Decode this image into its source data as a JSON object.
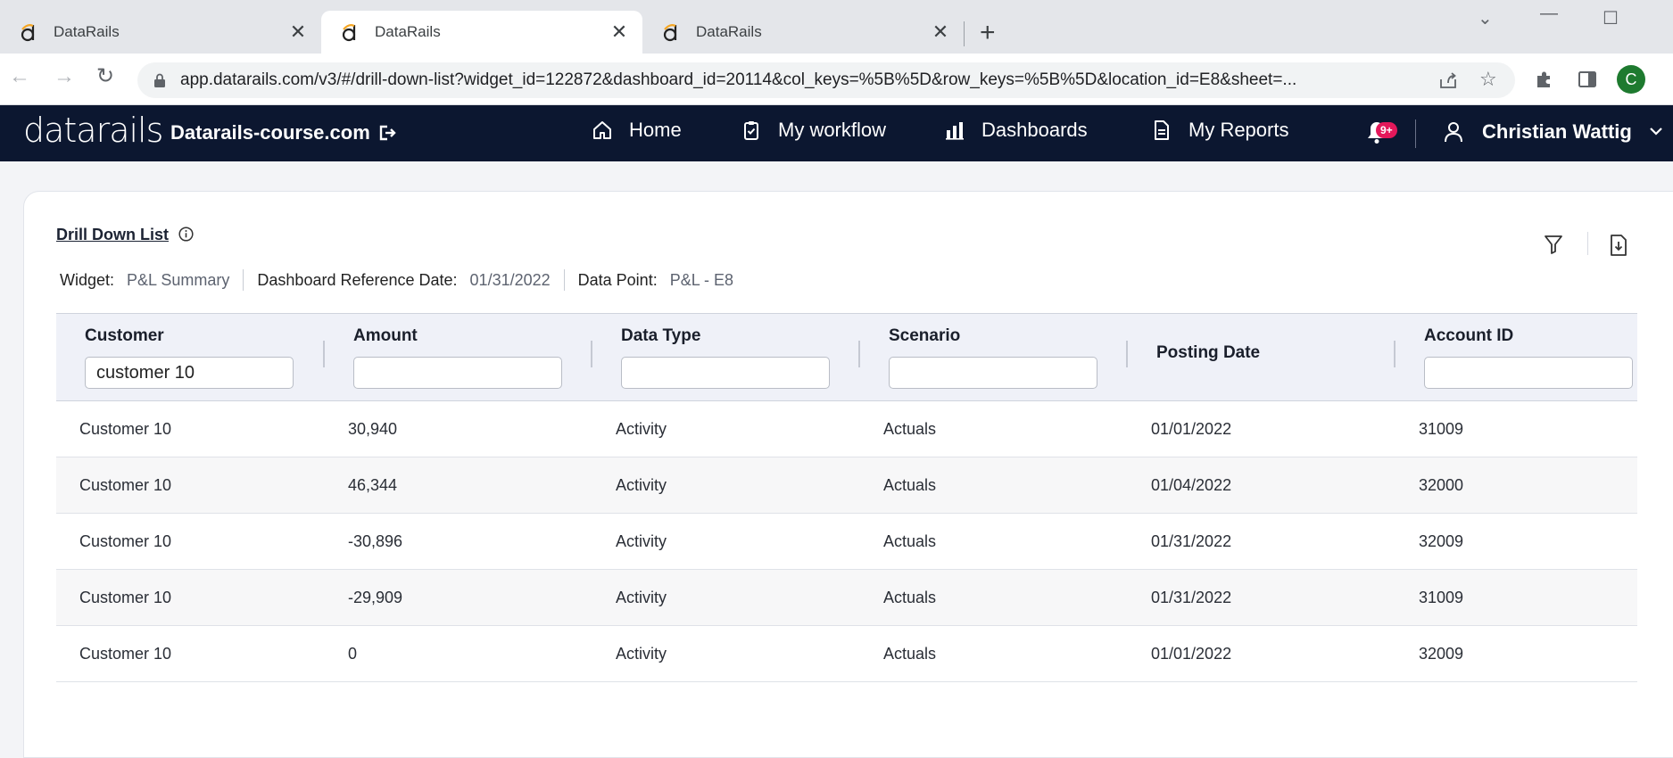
{
  "browser": {
    "tabs": [
      {
        "title": "DataRails"
      },
      {
        "title": "DataRails"
      },
      {
        "title": "DataRails"
      }
    ],
    "url": "app.datarails.com/v3/#/drill-down-list?widget_id=122872&dashboard_id=20114&col_keys=%5B%5D&row_keys=%5B%5D&location_id=E8&sheet=...",
    "profile_initial": "C"
  },
  "app": {
    "logo": "datarails",
    "org_name": "Datarails-course.com",
    "nav": [
      {
        "label": "Home",
        "icon": "home-icon"
      },
      {
        "label": "My workflow",
        "icon": "clipboard-check-icon"
      },
      {
        "label": "Dashboards",
        "icon": "bar-chart-icon"
      },
      {
        "label": "My Reports",
        "icon": "document-icon"
      }
    ],
    "notifications_badge": "9+",
    "user_name": "Christian Wattig"
  },
  "drilldown": {
    "title": "Drill Down List",
    "meta": {
      "widget_label": "Widget:",
      "widget_value": "P&L Summary",
      "ref_date_label": "Dashboard Reference Date:",
      "ref_date_value": "01/31/2022",
      "data_point_label": "Data Point:",
      "data_point_value": "P&L - E8"
    },
    "columns": [
      {
        "label": "Customer",
        "filter": "customer 10",
        "has_filter": true
      },
      {
        "label": "Amount",
        "filter": "",
        "has_filter": true
      },
      {
        "label": "Data Type",
        "filter": "",
        "has_filter": true
      },
      {
        "label": "Scenario",
        "filter": "",
        "has_filter": true
      },
      {
        "label": "Posting Date",
        "filter": "",
        "has_filter": false
      },
      {
        "label": "Account ID",
        "filter": "",
        "has_filter": true
      }
    ],
    "rows": [
      [
        "Customer 10",
        "30,940",
        "Activity",
        "Actuals",
        "01/01/2022",
        "31009"
      ],
      [
        "Customer 10",
        "46,344",
        "Activity",
        "Actuals",
        "01/04/2022",
        "32000"
      ],
      [
        "Customer 10",
        "-30,896",
        "Activity",
        "Actuals",
        "01/31/2022",
        "32009"
      ],
      [
        "Customer 10",
        "-29,909",
        "Activity",
        "Actuals",
        "01/31/2022",
        "31009"
      ],
      [
        "Customer 10",
        "0",
        "Activity",
        "Actuals",
        "01/01/2022",
        "32009"
      ]
    ]
  },
  "colors": {
    "appbar_bg": "#0c1730",
    "badge": "#e4185a",
    "table_header_bg": "#eff1f8"
  }
}
